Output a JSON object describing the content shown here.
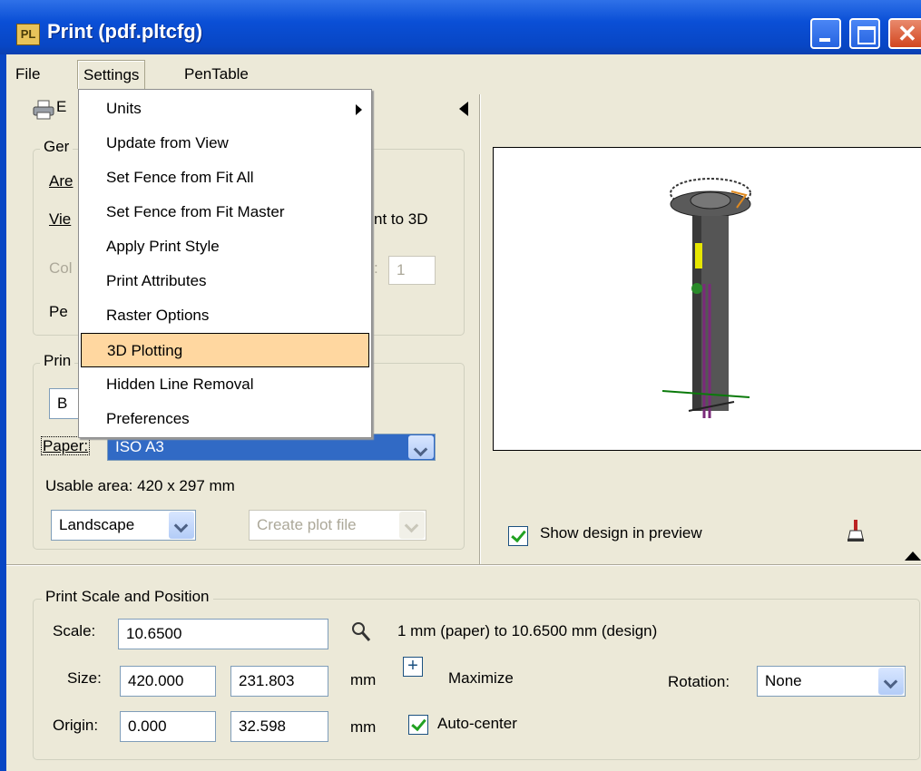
{
  "window": {
    "title": "Print  (pdf.pltcfg)",
    "icon_text": "PL"
  },
  "menubar": {
    "file": "File",
    "settings": "Settings",
    "pentable": "PenTable"
  },
  "general": {
    "group_label": "Ger",
    "area_label": "Are",
    "view_label": "Vie",
    "view_right_text": "nt to 3D",
    "color_label": "Col",
    "copies_suffix": ":",
    "copies_value": "1",
    "pen_label": "Pe"
  },
  "printer": {
    "group_label": "Prin",
    "driver_partial": "B",
    "paper_label": "Paper:",
    "paper_value": "ISO A3",
    "usable_area": "Usable area:  420 x 297 mm",
    "orientation": "Landscape",
    "create_plot": "Create plot file"
  },
  "preview": {
    "show_design": "Show design in preview"
  },
  "scale_position": {
    "group_label": "Print Scale and Position",
    "scale_label": "Scale:",
    "scale_value": "10.6500",
    "scale_description": "1 mm (paper) to 10.6500 mm (design)",
    "size_label": "Size:",
    "size_width": "420.000",
    "size_height": "231.803",
    "size_unit": "mm",
    "maximize": "Maximize",
    "rotation_label": "Rotation:",
    "rotation_value": "None",
    "origin_label": "Origin:",
    "origin_x": "0.000",
    "origin_y": "32.598",
    "origin_unit": "mm",
    "auto_center": "Auto-center"
  },
  "settings_menu": {
    "items": [
      "Units",
      "Update from View",
      "Set Fence from Fit All",
      "Set Fence from Fit Master",
      "Apply Print Style",
      "Print Attributes",
      "Raster Options",
      "3D Plotting",
      "Hidden Line Removal",
      "Preferences"
    ],
    "highlighted": "3D Plotting"
  },
  "colors": {
    "titlebar": "#0846c4",
    "highlight": "#ffd7a0",
    "selection": "#316ac5"
  }
}
